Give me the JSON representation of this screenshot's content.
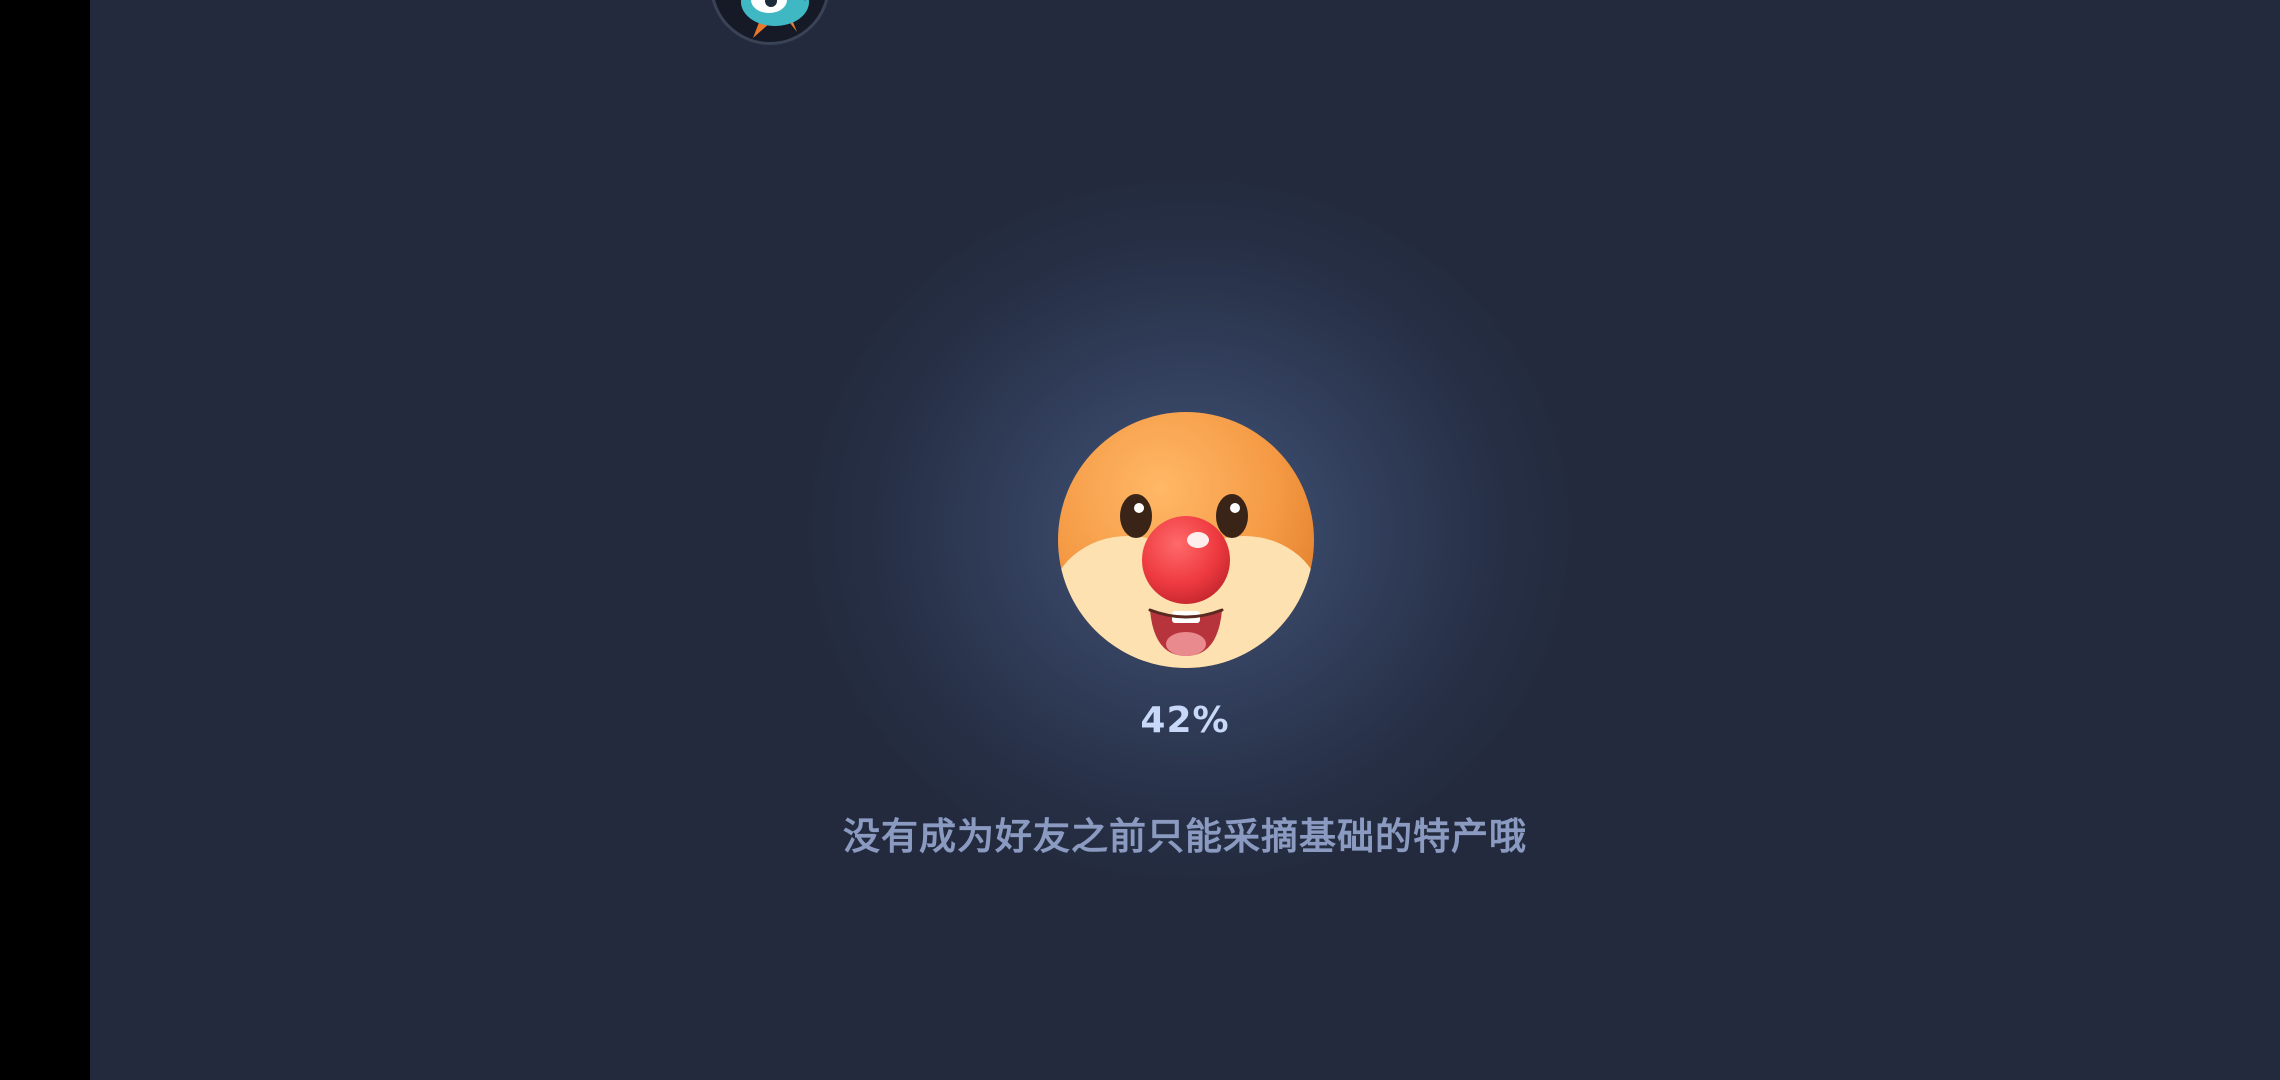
{
  "loading": {
    "progress_percent": 42,
    "progress_label": "42%",
    "tip": "没有成为好友之前只能采摘基础的特产哦"
  },
  "icons": {
    "mascot": "orange-clown-face-icon",
    "top_avatar": "blue-creature-avatar-icon"
  },
  "colors": {
    "background": "#232a3d",
    "mascot_orange": "#f59a45",
    "nose_red": "#ee3a40",
    "percent_text": "#c8d8f8",
    "tip_text": "#8a9ac0"
  }
}
